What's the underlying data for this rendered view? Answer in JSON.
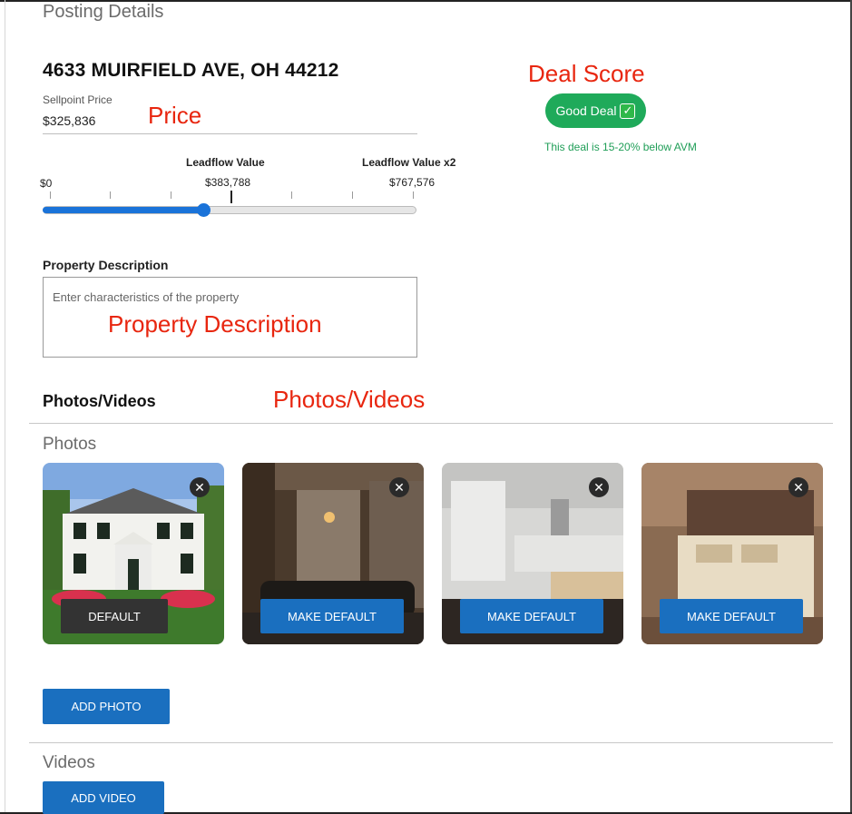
{
  "section": {
    "title": "Posting Details"
  },
  "listing": {
    "address": "4633 MUIRFIELD AVE, OH 44212",
    "price_label": "Sellpoint Price",
    "price_value": "$325,836"
  },
  "annotations": {
    "price": "Price",
    "deal_score": "Deal Score",
    "property_description": "Property Description",
    "photos_videos": "Photos/Videos"
  },
  "deal": {
    "badge_label": "Good Deal",
    "check_icon": "check-icon",
    "note": "This deal is 15-20% below AVM",
    "color": "#1faa5a"
  },
  "slider": {
    "min_label": "$0",
    "mid_header": "Leadflow Value",
    "mid_value": "$383,788",
    "max_header": "Leadflow Value x2",
    "max_value": "$767,576",
    "current_value": 325836,
    "max": 767576,
    "fill_fraction": 0.43,
    "color": "#1a73d9"
  },
  "description": {
    "label": "Property Description",
    "placeholder": "Enter characteristics of the property"
  },
  "media": {
    "heading": "Photos/Videos",
    "photos_heading": "Photos",
    "videos_heading": "Videos",
    "photos": [
      {
        "subject": "house-exterior",
        "button": "DEFAULT",
        "is_default": true
      },
      {
        "subject": "home-theater",
        "button": "MAKE DEFAULT",
        "is_default": false
      },
      {
        "subject": "kitchen",
        "button": "MAKE DEFAULT",
        "is_default": false
      },
      {
        "subject": "bedroom",
        "button": "MAKE DEFAULT",
        "is_default": false
      }
    ],
    "close_glyph": "✕",
    "add_photo": "ADD PHOTO",
    "add_video": "ADD VIDEO",
    "button_color": "#1a6fbf"
  }
}
